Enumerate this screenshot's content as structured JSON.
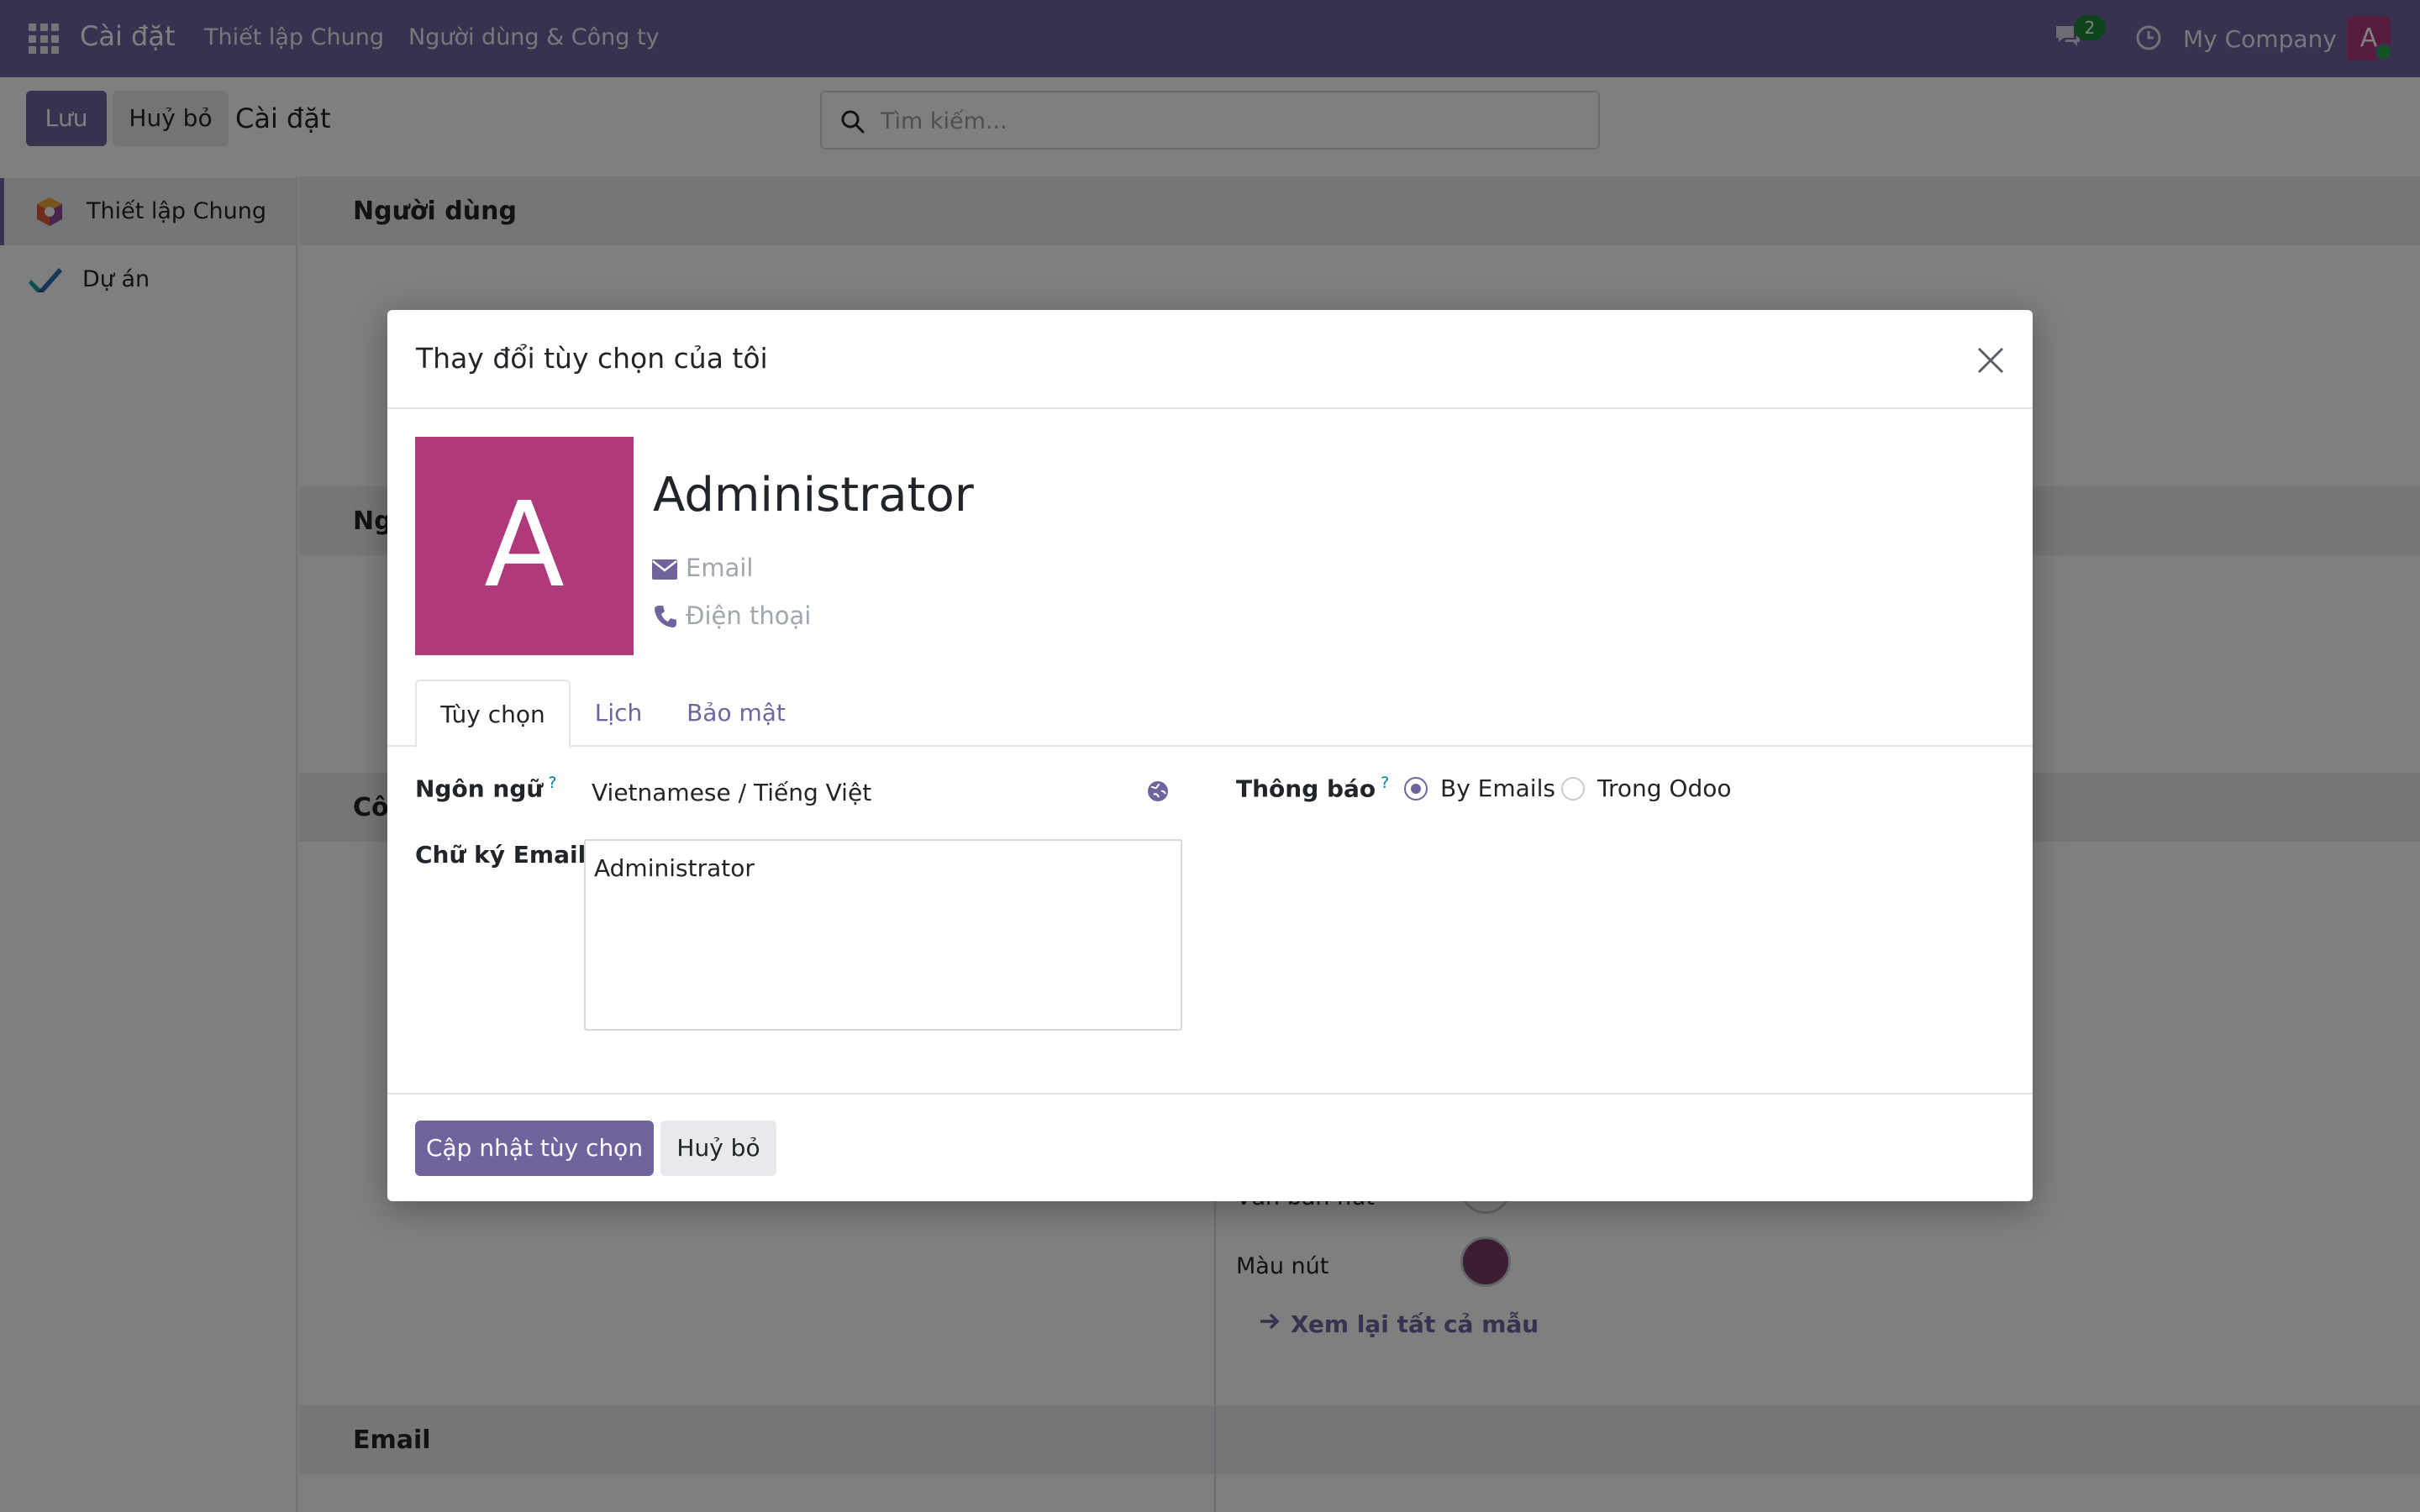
{
  "navbar": {
    "brand": "Cài đặt",
    "menu": [
      "Thiết lập Chung",
      "Người dùng & Công ty"
    ],
    "chat_count": "2",
    "company": "My Company",
    "avatar_letter": "A",
    "bg_color": "#71639e"
  },
  "control_panel": {
    "save_label": "Lưu",
    "discard_label": "Huỷ bỏ",
    "title": "Cài đặt",
    "search_placeholder": "Tìm kiếm..."
  },
  "sidebar": {
    "items": [
      {
        "label": "Thiết lập Chung",
        "icon": "settings-cube-icon",
        "active": true
      },
      {
        "label": "Dự án",
        "icon": "project-check-icon",
        "active": false
      }
    ]
  },
  "content": {
    "sections": [
      "Người dùng",
      "Ng",
      "Cô",
      "Email"
    ],
    "button_text_label": "Văn bản nút",
    "button_color_label": "Màu nút",
    "view_templates_link": "Xem lại tất cả mẫu"
  },
  "modal": {
    "title": "Thay đổi tùy chọn của tôi",
    "avatar_letter": "A",
    "avatar_color": "#b0397c",
    "name": "Administrator",
    "email_placeholder": "Email",
    "phone_placeholder": "Điện thoại",
    "tabs": [
      "Tùy chọn",
      "Lịch",
      "Bảo mật"
    ],
    "active_tab": "Tùy chọn",
    "language_label": "Ngôn ngữ",
    "language_value": "Vietnamese / Tiếng Việt",
    "signature_label": "Chữ ký Email",
    "signature_value": "Administrator",
    "notification_label": "Thông báo",
    "notification_options": [
      "By Emails",
      "Trong Odoo"
    ],
    "notification_selected": "By Emails",
    "help_mark": "?",
    "update_button": "Cập nhật tùy chọn",
    "cancel_button": "Huỷ bỏ"
  },
  "colors": {
    "primary": "#71639e",
    "success_badge": "#1f8a3a"
  }
}
